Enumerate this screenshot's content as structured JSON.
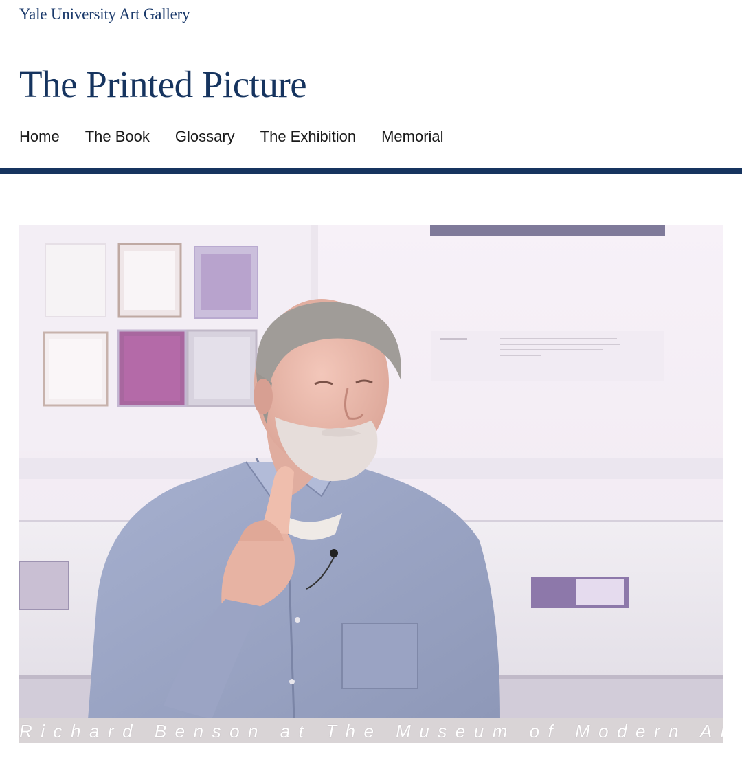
{
  "header": {
    "gallery_name": "Yale University Art Gallery",
    "site_title": "The Printed Picture"
  },
  "nav": {
    "items": [
      {
        "label": "Home"
      },
      {
        "label": "The Book"
      },
      {
        "label": "Glossary"
      },
      {
        "label": "The Exhibition"
      },
      {
        "label": "Memorial"
      }
    ]
  },
  "video": {
    "caption": "Richard Benson at The Museum of Modern Art"
  },
  "colors": {
    "brand_navy": "#16345f",
    "link_blue": "#1b3a6b",
    "nav_text": "#1a1a1a"
  }
}
